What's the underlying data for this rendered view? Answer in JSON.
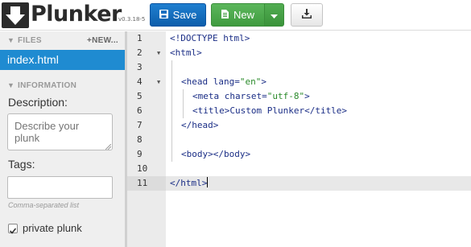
{
  "header": {
    "app_name": "Plunker",
    "version": "v0.3.18-5",
    "save_label": "Save",
    "new_label": "New",
    "icons": {
      "logo": "download-arrow-logo-icon",
      "save": "floppy-disk-icon",
      "new": "document-icon",
      "caret": "caret-down-icon",
      "download": "download-icon"
    },
    "colors": {
      "save": "#1a73c4",
      "new": "#4cab4c"
    }
  },
  "sidebar": {
    "files_heading": "FILES",
    "new_link": "+NEW...",
    "files": [
      {
        "name": "index.html",
        "selected": true
      }
    ],
    "information_heading": "INFORMATION",
    "description_label": "Description:",
    "description_placeholder": "Describe your plunk",
    "tags_label": "Tags:",
    "tags_help": "Comma-separated list",
    "private_label": "private plunk",
    "private_checked": true
  },
  "editor": {
    "active_line": 11,
    "lines": [
      {
        "n": "1",
        "text": "<!DOCTYPE html>"
      },
      {
        "n": "2",
        "text": "<html>",
        "fold": true
      },
      {
        "n": "3",
        "text": ""
      },
      {
        "n": "4",
        "text": "<head lang=\"en\">",
        "fold": true
      },
      {
        "n": "5",
        "text": "<meta charset=\"utf-8\">"
      },
      {
        "n": "6",
        "text": "<title>Custom Plunker</title>"
      },
      {
        "n": "7",
        "text": "</head>"
      },
      {
        "n": "8",
        "text": ""
      },
      {
        "n": "9",
        "text": "<body></body>"
      },
      {
        "n": "10",
        "text": ""
      },
      {
        "n": "11",
        "text": "</html>"
      }
    ]
  }
}
